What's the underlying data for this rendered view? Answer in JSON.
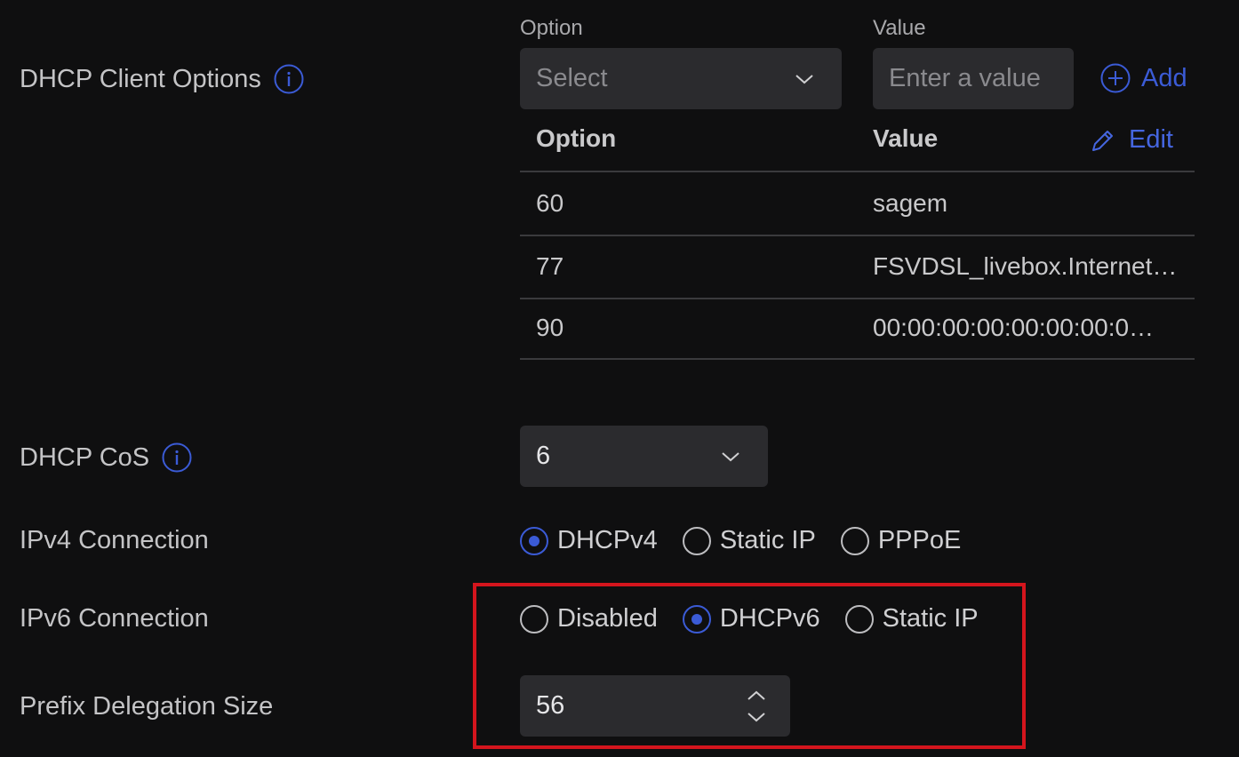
{
  "dhcp_client_options": {
    "label": "DHCP Client Options",
    "option_label": "Option",
    "value_label": "Value",
    "select_placeholder": "Select",
    "value_placeholder": "Enter a value",
    "add_label": "Add",
    "table": {
      "headers": {
        "option": "Option",
        "value": "Value"
      },
      "edit_label": "Edit",
      "rows": [
        {
          "option": "60",
          "value": "sagem"
        },
        {
          "option": "77",
          "value": "FSVDSL_livebox.Internet…"
        },
        {
          "option": "90",
          "value": "00:00:00:00:00:00:00:0…"
        }
      ]
    }
  },
  "dhcp_cos": {
    "label": "DHCP CoS",
    "value": "6"
  },
  "ipv4_connection": {
    "label": "IPv4 Connection",
    "options": [
      {
        "label": "DHCPv4",
        "selected": true
      },
      {
        "label": "Static IP",
        "selected": false
      },
      {
        "label": "PPPoE",
        "selected": false
      }
    ]
  },
  "ipv6_connection": {
    "label": "IPv6 Connection",
    "options": [
      {
        "label": "Disabled",
        "selected": false
      },
      {
        "label": "DHCPv6",
        "selected": true
      },
      {
        "label": "Static IP",
        "selected": false
      }
    ]
  },
  "prefix_delegation": {
    "label": "Prefix Delegation Size",
    "value": "56"
  },
  "colors": {
    "accent": "#3b5bd6",
    "highlight": "#d4151d",
    "background": "#0f0f10",
    "field": "#2b2b2e"
  }
}
